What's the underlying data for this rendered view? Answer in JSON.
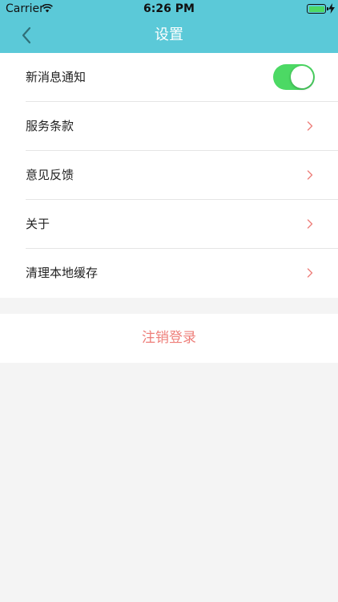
{
  "status_bar": {
    "carrier": "Carrier",
    "time": "6:26 PM",
    "battery_color": "#4cd964"
  },
  "nav": {
    "title": "设置",
    "back_icon": "chevron-left-icon",
    "background_color": "#5bc9d8"
  },
  "settings": {
    "items": [
      {
        "label": "新消息通知",
        "control": "toggle",
        "toggle_on": true
      },
      {
        "label": "服务条款",
        "control": "chevron"
      },
      {
        "label": "意见反馈",
        "control": "chevron"
      },
      {
        "label": "关于",
        "control": "chevron"
      },
      {
        "label": "清理本地缓存",
        "control": "chevron"
      }
    ],
    "chevron_color": "#ee7f7a",
    "toggle_color": "#4cd964"
  },
  "logout": {
    "label": "注销登录",
    "color": "#ee7f7a"
  }
}
